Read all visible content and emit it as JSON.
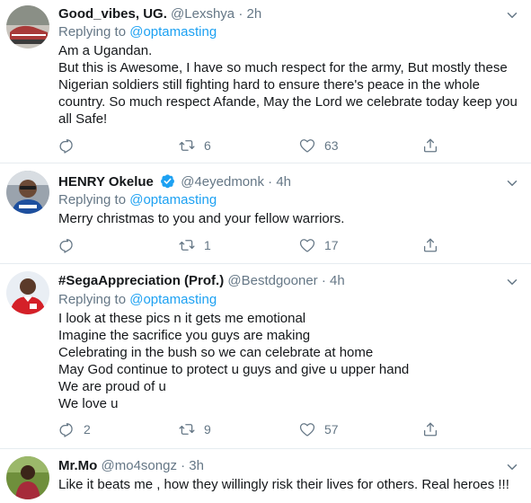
{
  "tweets": [
    {
      "name": "Good_vibes, UG.",
      "handle": "@Lexshya",
      "time": "2h",
      "replying_prefix": "Replying to",
      "replying_to": "@optamasting",
      "lines": [
        "Am a Ugandan.",
        "But this is Awesome, I have so much respect for the army, But mostly these",
        "Nigerian soldiers still fighting hard to ensure there's peace in the whole",
        "country. So much respect Afande, May the Lord we celebrate today keep you",
        "all Safe!"
      ],
      "replies": "",
      "retweets": "6",
      "likes": "63",
      "verified": false
    },
    {
      "name": "HENRY Okelue",
      "handle": "@4eyedmonk",
      "time": "4h",
      "replying_prefix": "Replying to",
      "replying_to": "@optamasting",
      "lines": [
        "Merry christmas to you and your fellow warriors."
      ],
      "replies": "",
      "retweets": "1",
      "likes": "17",
      "verified": true
    },
    {
      "name": "#SegaAppreciation (Prof.)",
      "handle": "@Bestdgooner",
      "time": "4h",
      "replying_prefix": "Replying to",
      "replying_to": "@optamasting",
      "lines": [
        "I look at these pics n it gets me emotional",
        "Imagine the sacrifice you guys are making",
        "Celebrating in the bush so we can celebrate at home",
        "May God continue to protect u guys and give u upper hand",
        "We are proud of u",
        "We love u"
      ],
      "replies": "2",
      "retweets": "9",
      "likes": "57",
      "verified": false
    },
    {
      "name": "Mr.Mo",
      "handle": "@mo4songz",
      "time": "3h",
      "lines": [
        "Like it beats me , how they willingly risk their lives for others. Real heroes !!!"
      ],
      "verified": false
    }
  ],
  "separator": "·",
  "colors": {
    "accent": "#1da1f2",
    "muted": "#657786",
    "text": "#14171a",
    "border": "#e6ecf0"
  },
  "icons": [
    "reply-icon",
    "retweet-icon",
    "like-icon",
    "share-icon",
    "caret-down-icon",
    "verified-badge-icon"
  ]
}
